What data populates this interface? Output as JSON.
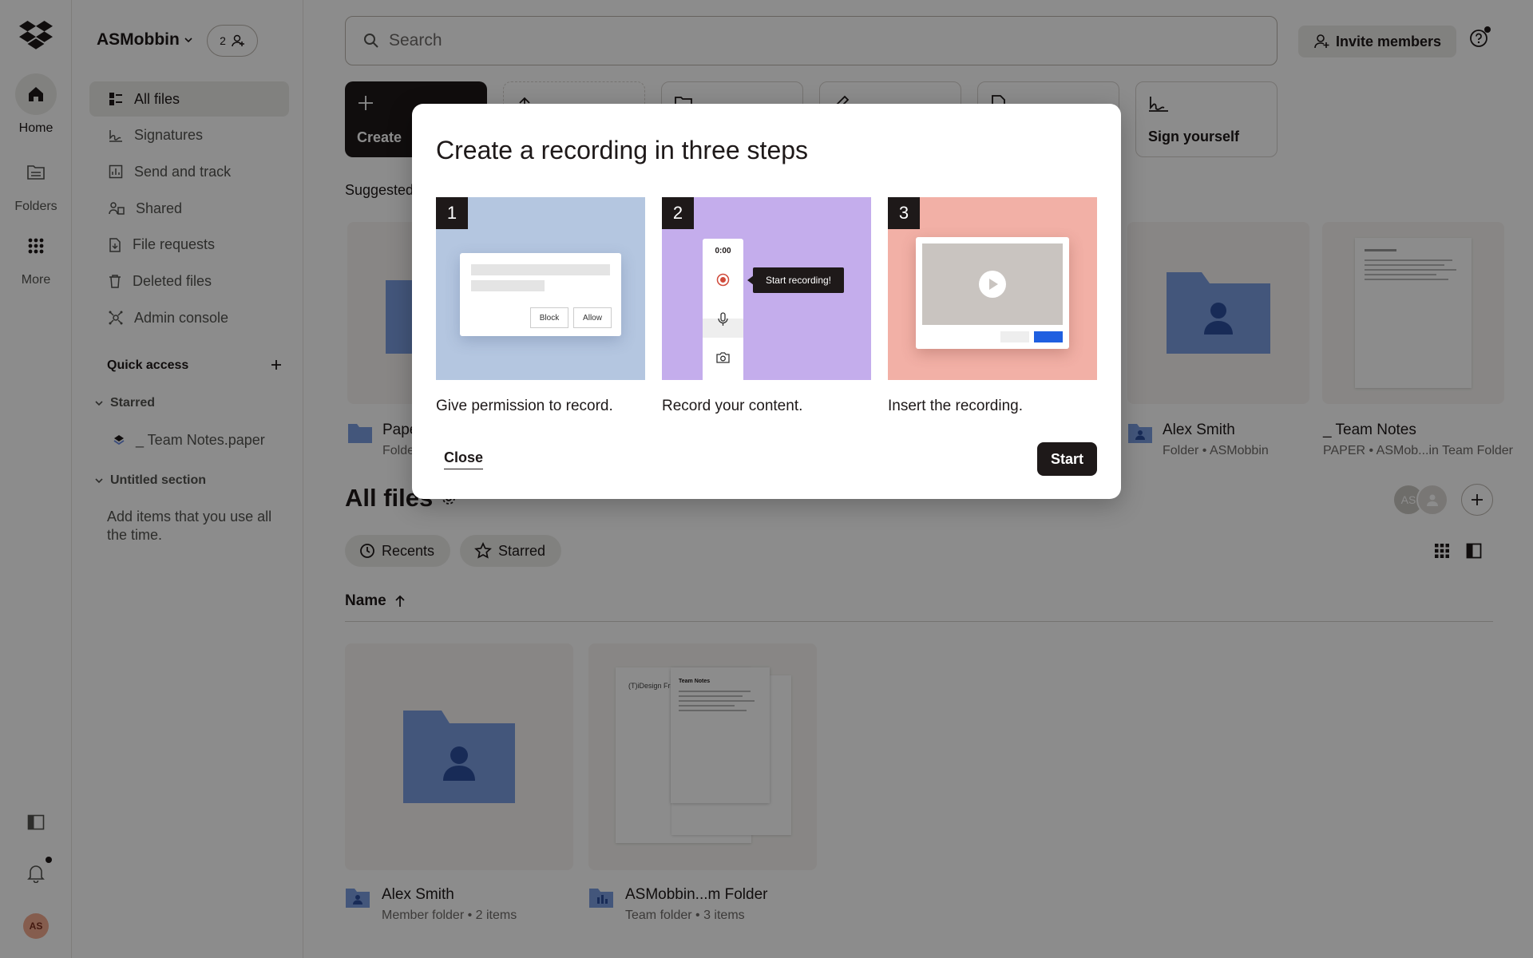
{
  "rail": {
    "items": [
      {
        "label": "Home",
        "icon": "home-icon"
      },
      {
        "label": "Folders",
        "icon": "folder-icon"
      },
      {
        "label": "More",
        "icon": "grid-icon"
      }
    ],
    "avatar_initials": "AS"
  },
  "sidebar": {
    "team_name": "ASMobbin",
    "member_count": "2",
    "nav": [
      {
        "label": "All files",
        "icon": "all-files-icon",
        "active": true
      },
      {
        "label": "Signatures",
        "icon": "signature-icon"
      },
      {
        "label": "Send and track",
        "icon": "chart-icon"
      },
      {
        "label": "Shared",
        "icon": "shared-icon"
      },
      {
        "label": "File requests",
        "icon": "file-request-icon"
      },
      {
        "label": "Deleted files",
        "icon": "trash-icon"
      },
      {
        "label": "Admin console",
        "icon": "admin-icon"
      }
    ],
    "quick_access": "Quick access",
    "starred_section": "Starred",
    "starred_file": "_ Team Notes.paper",
    "untitled_section": "Untitled section",
    "add_hint": "Add items that you use all the time."
  },
  "header": {
    "search_placeholder": "Search",
    "invite_label": "Invite members"
  },
  "tiles": {
    "create": "Create",
    "sign_yourself": "Sign yourself"
  },
  "suggested": {
    "heading": "Suggested",
    "items": [
      {
        "title": "Pape",
        "subtitle": "Folde"
      },
      {
        "title": "Alex Smith",
        "subtitle": "Folder • ASMobbin"
      },
      {
        "title": "_ Team Notes",
        "subtitle": "PAPER • ASMob...in Team Folder"
      }
    ]
  },
  "all_files": {
    "title": "All files",
    "chips": [
      "Recents",
      "Starred"
    ],
    "avatar_initials": "AS",
    "name_header": "Name",
    "files": [
      {
        "title": "Alex Smith",
        "subtitle": "Member folder • 2 items"
      },
      {
        "title": "ASMobbin...m Folder",
        "subtitle": "Team folder • 3 items"
      }
    ],
    "thumb_text_1": "(T)iDesign Fra",
    "thumb_text_2": "Team Notes"
  },
  "modal": {
    "title": "Create a recording in three steps",
    "steps": [
      {
        "num": "1",
        "caption": "Give permission to record.",
        "block": "Block",
        "allow": "Allow"
      },
      {
        "num": "2",
        "caption": "Record your content.",
        "timer": "0:00",
        "tooltip": "Start recording!"
      },
      {
        "num": "3",
        "caption": "Insert the recording."
      }
    ],
    "close_label": "Close",
    "start_label": "Start"
  },
  "colors": {
    "ink": "#1e1919",
    "folder_blue": "#7b9de0",
    "step1_bg": "#b4c6e0",
    "step2_bg": "#c4adec",
    "step3_bg": "#f2b0a6",
    "accent_blue": "#1f5fe0"
  }
}
